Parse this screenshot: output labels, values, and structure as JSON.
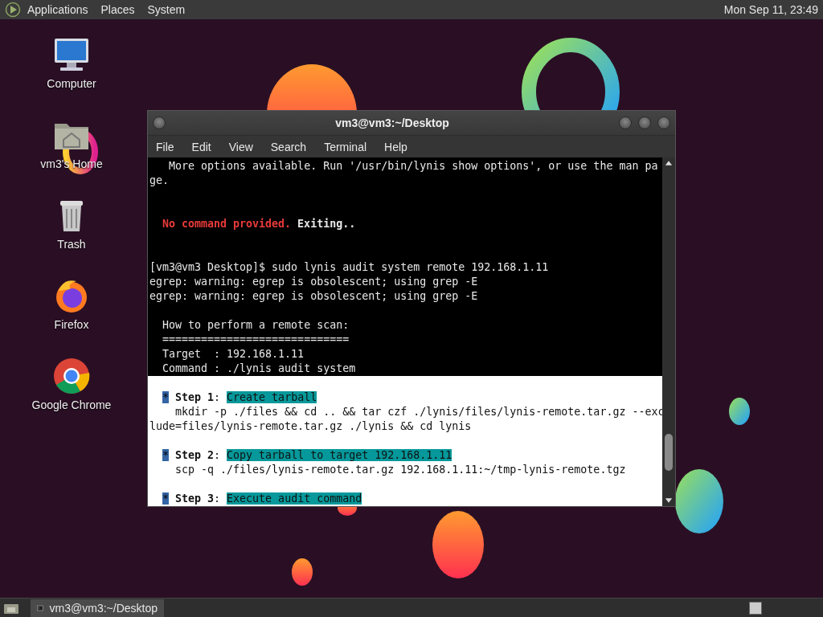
{
  "top_panel": {
    "menus": [
      "Applications",
      "Places",
      "System"
    ],
    "clock": "Mon Sep 11, 23:49"
  },
  "desktop_icons": [
    {
      "label": "Computer",
      "kind": "computer"
    },
    {
      "label": "vm3's Home",
      "kind": "home"
    },
    {
      "label": "Trash",
      "kind": "trash"
    },
    {
      "label": "Firefox",
      "kind": "firefox"
    },
    {
      "label": "Google Chrome",
      "kind": "chrome"
    }
  ],
  "window": {
    "title": "vm3@vm3:~/Desktop",
    "menu": [
      "File",
      "Edit",
      "View",
      "Search",
      "Terminal",
      "Help"
    ],
    "blocks": [
      {
        "inverse": false,
        "lines": [
          {
            "kind": "plain",
            "segments": [
              {
                "kind": "text",
                "text": "   More options available. Run '/usr/bin/lynis show options', or use the man pa"
              }
            ]
          },
          {
            "kind": "plain",
            "segments": [
              {
                "kind": "text",
                "text": "ge."
              }
            ]
          },
          {
            "kind": "double_spaced",
            "indent": true,
            "segments": [
              {
                "kind": "error",
                "text": "No command provided."
              },
              {
                "kind": "bold",
                "text": " Exiting.."
              }
            ]
          },
          {
            "kind": "double_spaced",
            "segments": [
              {
                "kind": "text",
                "text": "[vm3@vm3 Desktop]$ sudo lynis audit system remote 192.168.1.11"
              }
            ]
          },
          {
            "kind": "plain",
            "segments": [
              {
                "kind": "text",
                "text": "egrep: warning: egrep is obsolescent; using grep -E"
              }
            ]
          },
          {
            "kind": "plain",
            "segments": [
              {
                "kind": "text",
                "text": "egrep: warning: egrep is obsolescent; using grep -E"
              }
            ]
          },
          {
            "kind": "spaced",
            "segments": [
              {
                "kind": "text",
                "text": "  How to perform a remote scan:"
              }
            ]
          },
          {
            "kind": "plain",
            "segments": [
              {
                "kind": "text",
                "text": "  ============================="
              }
            ]
          },
          {
            "kind": "plain",
            "segments": [
              {
                "kind": "text",
                "text": "  Target  : 192.168.1.11"
              }
            ]
          },
          {
            "kind": "plain",
            "segments": [
              {
                "kind": "text",
                "text": "  Command : ./lynis audit system"
              }
            ]
          }
        ]
      },
      {
        "inverse": true,
        "lines": [
          {
            "kind": "spaced",
            "indent": true,
            "segments": [
              {
                "kind": "bullet",
                "text": "*"
              },
              {
                "kind": "bold",
                "text": " Step 1"
              },
              {
                "kind": "text",
                "text": ": "
              },
              {
                "kind": "highlight",
                "text": "Create tarball"
              }
            ]
          },
          {
            "kind": "plain",
            "segments": [
              {
                "kind": "text",
                "text": "    mkdir -p ./files && cd .. && tar czf ./lynis/files/lynis-remote.tar.gz --exc"
              }
            ]
          },
          {
            "kind": "plain",
            "segments": [
              {
                "kind": "text",
                "text": "lude=files/lynis-remote.tar.gz ./lynis && cd lynis"
              }
            ]
          },
          {
            "kind": "spaced",
            "indent": true,
            "segments": [
              {
                "kind": "bullet",
                "text": "*"
              },
              {
                "kind": "bold",
                "text": " Step 2"
              },
              {
                "kind": "text",
                "text": ": "
              },
              {
                "kind": "highlight",
                "text": "Copy tarball to target 192.168.1.11"
              }
            ]
          },
          {
            "kind": "plain",
            "segments": [
              {
                "kind": "text",
                "text": "    scp -q ./files/lynis-remote.tar.gz 192.168.1.11:~/tmp-lynis-remote.tgz"
              }
            ]
          },
          {
            "kind": "spaced",
            "indent": true,
            "segments": [
              {
                "kind": "bullet",
                "text": "*"
              },
              {
                "kind": "bold",
                "text": " Step 3"
              },
              {
                "kind": "text",
                "text": ": "
              },
              {
                "kind": "highlight",
                "text": "Execute audit command"
              }
            ]
          }
        ]
      }
    ]
  },
  "taskbar": {
    "tasks": [
      {
        "label": "vm3@vm3:~/Desktop",
        "selected": true
      }
    ]
  }
}
